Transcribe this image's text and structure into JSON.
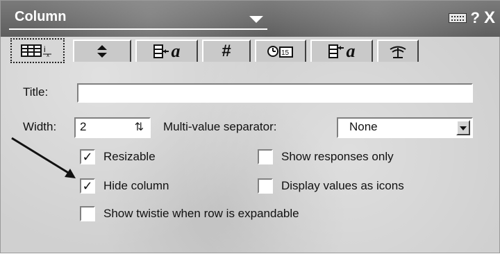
{
  "titlebar": {
    "title": "Column",
    "help_glyph": "?",
    "close_glyph": "X",
    "icons": [
      "keyboard-icon",
      "help-icon",
      "close-icon"
    ]
  },
  "tabs": [
    {
      "name": "column-info-tab",
      "icon": "column-grid-icon",
      "glyph": ""
    },
    {
      "name": "sorting-tab",
      "icon": "sort-arrows-icon",
      "glyph": "◆"
    },
    {
      "name": "title-font-tab",
      "icon": "font-a-icon",
      "glyph": "a"
    },
    {
      "name": "number-format-tab",
      "icon": "hash-icon",
      "glyph": "#"
    },
    {
      "name": "date-time-tab",
      "icon": "clock-calendar-icon",
      "glyph": "15"
    },
    {
      "name": "header-font-tab",
      "icon": "font-a-icon",
      "glyph": "a"
    },
    {
      "name": "advanced-tab",
      "icon": "advanced-icon",
      "glyph": "ⓒ"
    }
  ],
  "form": {
    "title_label": "Title:",
    "title_value": "",
    "width_label": "Width:",
    "width_value": "2",
    "separator_label": "Multi-value separator:",
    "separator_value": "None"
  },
  "checkboxes": {
    "resizable": {
      "label": "Resizable",
      "checked": true
    },
    "show_responses_only": {
      "label": "Show responses only",
      "checked": false
    },
    "hide_column": {
      "label": "Hide column",
      "checked": true
    },
    "display_values_as_icons": {
      "label": "Display values as icons",
      "checked": false
    },
    "show_twistie": {
      "label": "Show twistie when row is expandable",
      "checked": false
    }
  },
  "colors": {
    "titlebar": "#6b6b6b",
    "panel": "#d0d0d0",
    "field": "#ffffff",
    "text": "#111111"
  }
}
